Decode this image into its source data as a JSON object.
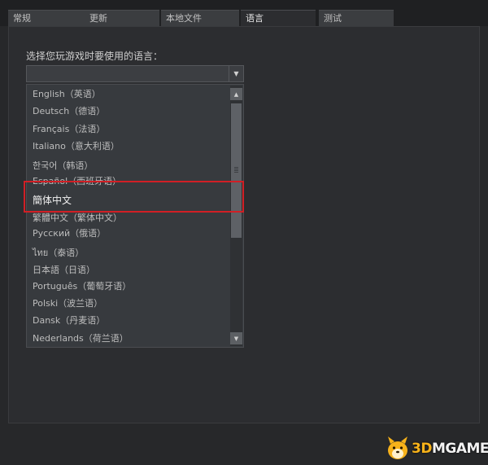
{
  "tabs": [
    {
      "label": "常规"
    },
    {
      "label": "更新"
    },
    {
      "label": "本地文件"
    },
    {
      "label": "语言",
      "active": true
    },
    {
      "label": "测试"
    }
  ],
  "language": {
    "prompt": "选择您玩游戏时要使用的语言：",
    "selected_value": "",
    "options": [
      "English（英语）",
      "Deutsch（德语）",
      "Français（法语）",
      "Italiano（意大利语）",
      "한국어（韩语）",
      "Español（西班牙语）",
      "簡体中文",
      "繁體中文（繁体中文）",
      "Русский（俄语）",
      "ไทย（泰语）",
      "日本語（日语）",
      "Português（葡萄牙语）",
      "Polski（波兰语）",
      "Dansk（丹麦语）",
      "Nederlands（荷兰语）"
    ],
    "highlighted_option": "簡体中文"
  },
  "watermark": {
    "brand": "3DMGAME"
  },
  "colors": {
    "background": "#27282a",
    "panel": "#2c2d30",
    "highlight_border": "#d11f25",
    "watermark_accent": "#f7b21a"
  }
}
